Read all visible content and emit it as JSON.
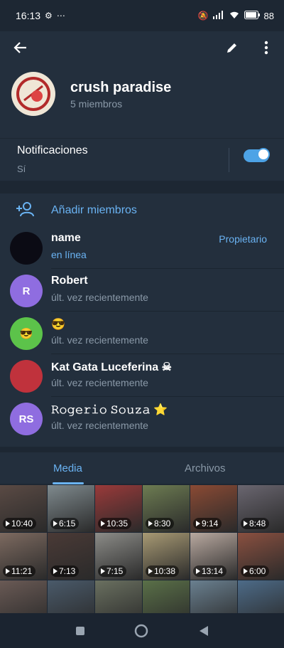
{
  "status": {
    "time": "16:13",
    "battery": "88"
  },
  "group": {
    "title": "crush paradise",
    "subtitle": "5 miembros"
  },
  "notifications": {
    "label": "Notificaciones",
    "value": "Sí",
    "enabled": true
  },
  "add_members": {
    "label": "Añadir miembros"
  },
  "members": [
    {
      "name": "name",
      "status": "en línea",
      "role": "Propietario",
      "avatar_text": "",
      "avatar_color": "#0b0b14",
      "online": true
    },
    {
      "name": "Robert",
      "status": "últ. vez recientemente",
      "role": "",
      "avatar_text": "R",
      "avatar_color": "#8f6de0",
      "online": false
    },
    {
      "name": "😎",
      "status": "últ. vez recientemente",
      "role": "",
      "avatar_text": "😎",
      "avatar_color": "#5cc34a",
      "online": false
    },
    {
      "name": "Kat Gata Luceferina ☠",
      "status": "últ. vez recientemente",
      "role": "",
      "avatar_text": "",
      "avatar_color": "#c0323c",
      "online": false
    },
    {
      "name": "𝚁𝚘𝚐𝚎𝚛𝚒𝚘 𝚂𝚘𝚞𝚣𝚊 ⭐",
      "status": "últ. vez recientemente",
      "role": "",
      "avatar_text": "RS",
      "avatar_color": "#8f6de0",
      "online": false
    }
  ],
  "tabs": [
    {
      "label": "Media",
      "active": true
    },
    {
      "label": "Archivos",
      "active": false
    }
  ],
  "media": [
    {
      "duration": "10:40",
      "color": "#5a4a44"
    },
    {
      "duration": "6:15",
      "color": "#7f8a8e"
    },
    {
      "duration": "10:35",
      "color": "#9a3a3a"
    },
    {
      "duration": "8:30",
      "color": "#6d7c52"
    },
    {
      "duration": "9:14",
      "color": "#8a4a34"
    },
    {
      "duration": "8:48",
      "color": "#6a6670"
    },
    {
      "duration": "11:21",
      "color": "#7d6a60"
    },
    {
      "duration": "7:13",
      "color": "#4a3a36"
    },
    {
      "duration": "7:15",
      "color": "#8c8c88"
    },
    {
      "duration": "10:38",
      "color": "#a89a74"
    },
    {
      "duration": "13:14",
      "color": "#b9a9a0"
    },
    {
      "duration": "6:00",
      "color": "#8a5040"
    },
    {
      "duration": "",
      "color": "#6a5a55"
    },
    {
      "duration": "",
      "color": "#4a5a6a"
    },
    {
      "duration": "",
      "color": "#6a7060"
    },
    {
      "duration": "",
      "color": "#5a7048"
    },
    {
      "duration": "",
      "color": "#6a8090"
    },
    {
      "duration": "",
      "color": "#4d6b88"
    }
  ]
}
